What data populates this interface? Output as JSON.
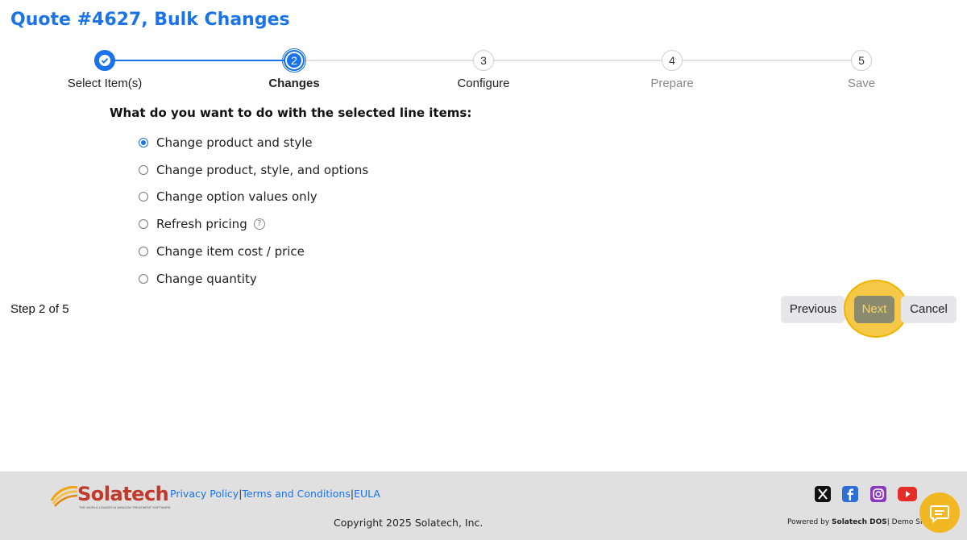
{
  "page": {
    "title": "Quote #4627, Bulk Changes"
  },
  "stepper": {
    "steps": [
      {
        "number": "✓",
        "label": "Select Item(s)",
        "state": "complete"
      },
      {
        "number": "2",
        "label": "Changes",
        "state": "current"
      },
      {
        "number": "3",
        "label": "Configure",
        "state": "upcoming"
      },
      {
        "number": "4",
        "label": "Prepare",
        "state": "future"
      },
      {
        "number": "5",
        "label": "Save",
        "state": "future"
      }
    ]
  },
  "question": "What do you want to do with the selected line items:",
  "options": [
    {
      "label": "Change product and style",
      "checked": true
    },
    {
      "label": "Change product, style, and options",
      "checked": false
    },
    {
      "label": "Change option values only",
      "checked": false
    },
    {
      "label": "Refresh pricing",
      "checked": false,
      "help": "?"
    },
    {
      "label": "Change item cost / price",
      "checked": false
    },
    {
      "label": "Change quantity",
      "checked": false
    }
  ],
  "step_indicator": "Step 2 of 5",
  "buttons": {
    "previous": "Previous",
    "next": "Next",
    "cancel": "Cancel"
  },
  "footer": {
    "logo_text": "Solatech",
    "logo_tagline": "THE WORLD LEADER IN WINDOW TREATMENT SOFTWARE",
    "links": {
      "privacy": "Privacy Policy",
      "sep1": "|",
      "terms": "Terms and Conditions",
      "sep2": "|",
      "eula": "EULA"
    },
    "copyright": "Copyright 2025 Solatech, Inc.",
    "powered_prefix": "Powered by ",
    "powered_brand": "Solatech DOS",
    "powered_suffix": "| Demo Site",
    "social": [
      "x-icon",
      "facebook-icon",
      "instagram-icon",
      "youtube-icon"
    ]
  },
  "colors": {
    "accent": "#1a73e8",
    "highlight": "#f2b824"
  }
}
